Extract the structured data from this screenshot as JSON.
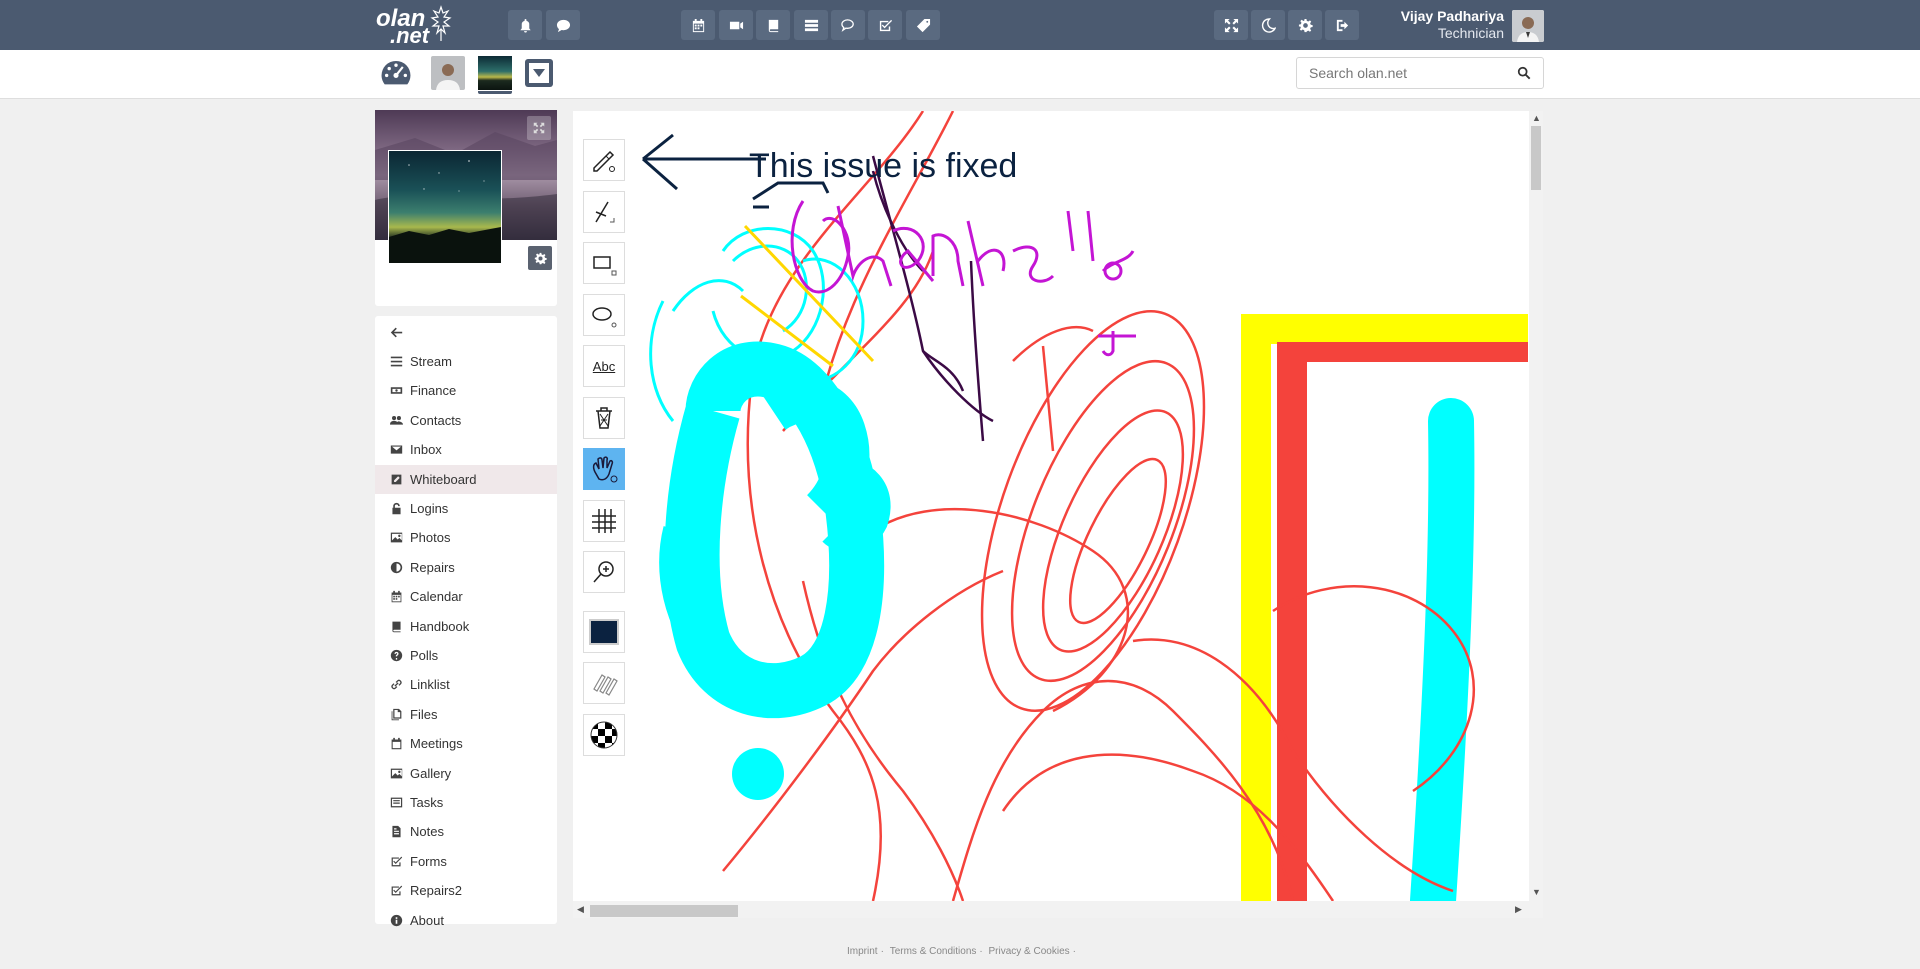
{
  "app": {
    "logo_line1": "olan",
    "logo_line2": ".net",
    "user_name": "Vijay Padhariya",
    "user_role": "Technician",
    "colors": {
      "topbar": "#4b5a70",
      "active_tool": "#5eb4f0",
      "active_menu": "#f0e8ea"
    }
  },
  "topbar": {
    "left_icons": [
      "bell-icon",
      "chat-icon"
    ],
    "center_icons": [
      "calendar-icon",
      "video-icon",
      "book-icon",
      "list-icon",
      "comments-icon",
      "check-square-icon",
      "tag-icon"
    ],
    "right_icons": [
      "expand-icon",
      "moon-icon",
      "gear-icon",
      "signout-icon"
    ]
  },
  "search": {
    "placeholder": "Search olan.net"
  },
  "menu": {
    "back_icon": "arrow-left-icon",
    "items": [
      {
        "label": "Stream",
        "icon": "bars-icon"
      },
      {
        "label": "Finance",
        "icon": "money-icon"
      },
      {
        "label": "Contacts",
        "icon": "users-icon"
      },
      {
        "label": "Inbox",
        "icon": "envelope-icon"
      },
      {
        "label": "Whiteboard",
        "icon": "edit-icon",
        "active": true
      },
      {
        "label": "Logins",
        "icon": "unlock-icon"
      },
      {
        "label": "Photos",
        "icon": "image-icon"
      },
      {
        "label": "Repairs",
        "icon": "adjust-icon"
      },
      {
        "label": "Calendar",
        "icon": "calendar-icon"
      },
      {
        "label": "Handbook",
        "icon": "book-icon"
      },
      {
        "label": "Polls",
        "icon": "question-circle-icon"
      },
      {
        "label": "Linklist",
        "icon": "link-icon"
      },
      {
        "label": "Files",
        "icon": "copy-icon"
      },
      {
        "label": "Meetings",
        "icon": "calendar-empty-icon"
      },
      {
        "label": "Gallery",
        "icon": "image-icon"
      },
      {
        "label": "Tasks",
        "icon": "tasks-icon"
      },
      {
        "label": "Notes",
        "icon": "file-text-icon"
      },
      {
        "label": "Forms",
        "icon": "check-square-icon"
      },
      {
        "label": "Repairs2",
        "icon": "check-square-icon"
      },
      {
        "label": "About",
        "icon": "info-circle-icon"
      }
    ]
  },
  "whiteboard": {
    "typed_text": "This issue is fixed",
    "tools": [
      "pencil-tool",
      "line-tool",
      "rectangle-tool",
      "ellipse-tool",
      "text-tool",
      "trash-tool",
      "pan-tool",
      "grid-tool",
      "zoom-tool",
      "color-swatch",
      "brush-size-tool",
      "transparency-tool"
    ],
    "text_tool_label": "Abc",
    "active_tool": "pan-tool",
    "current_color": "#0b2240"
  },
  "footer": {
    "links": [
      "Imprint",
      "Terms & Conditions",
      "Privacy & Cookies"
    ]
  }
}
